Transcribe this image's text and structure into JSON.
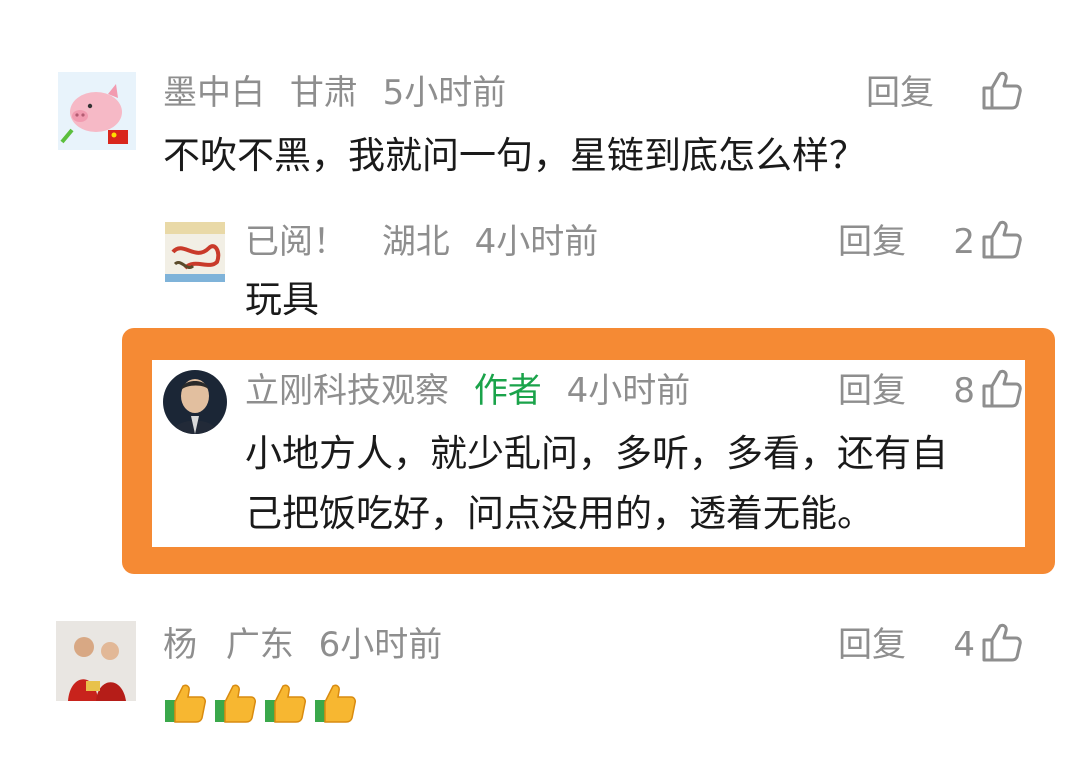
{
  "comments": [
    {
      "username": "墨中白",
      "location": "甘肃",
      "time": "5小时前",
      "reply_label": "回复",
      "likes": "",
      "text": "不吹不黑，我就问一句，星链到底怎么样？"
    },
    {
      "username": "已阅！",
      "location": "湖北",
      "time": "4小时前",
      "reply_label": "回复",
      "likes": "2",
      "text": "玩具"
    },
    {
      "username": "立刚科技观察",
      "badge": "作者",
      "time": "4小时前",
      "reply_label": "回复",
      "likes": "8",
      "text_line1": "小地方人，就少乱问，多听，多看，还有自",
      "text_line2": "己把饭吃好，问点没用的，透着无能。"
    },
    {
      "username": "杨",
      "location": "广东",
      "time": "6小时前",
      "reply_label": "回复",
      "likes": "4",
      "emoji": "👍👍👍👍"
    }
  ],
  "colors": {
    "highlight": "#f58a34",
    "author_badge": "#1aa34a",
    "meta_text": "#8e8e8e",
    "body_text": "#1a1a1a"
  },
  "avatars": {
    "c1": "pig-cartoon-avatar",
    "c2": "dragon-avatar",
    "c3": "man-portrait-avatar",
    "c4": "family-photo-avatar"
  }
}
